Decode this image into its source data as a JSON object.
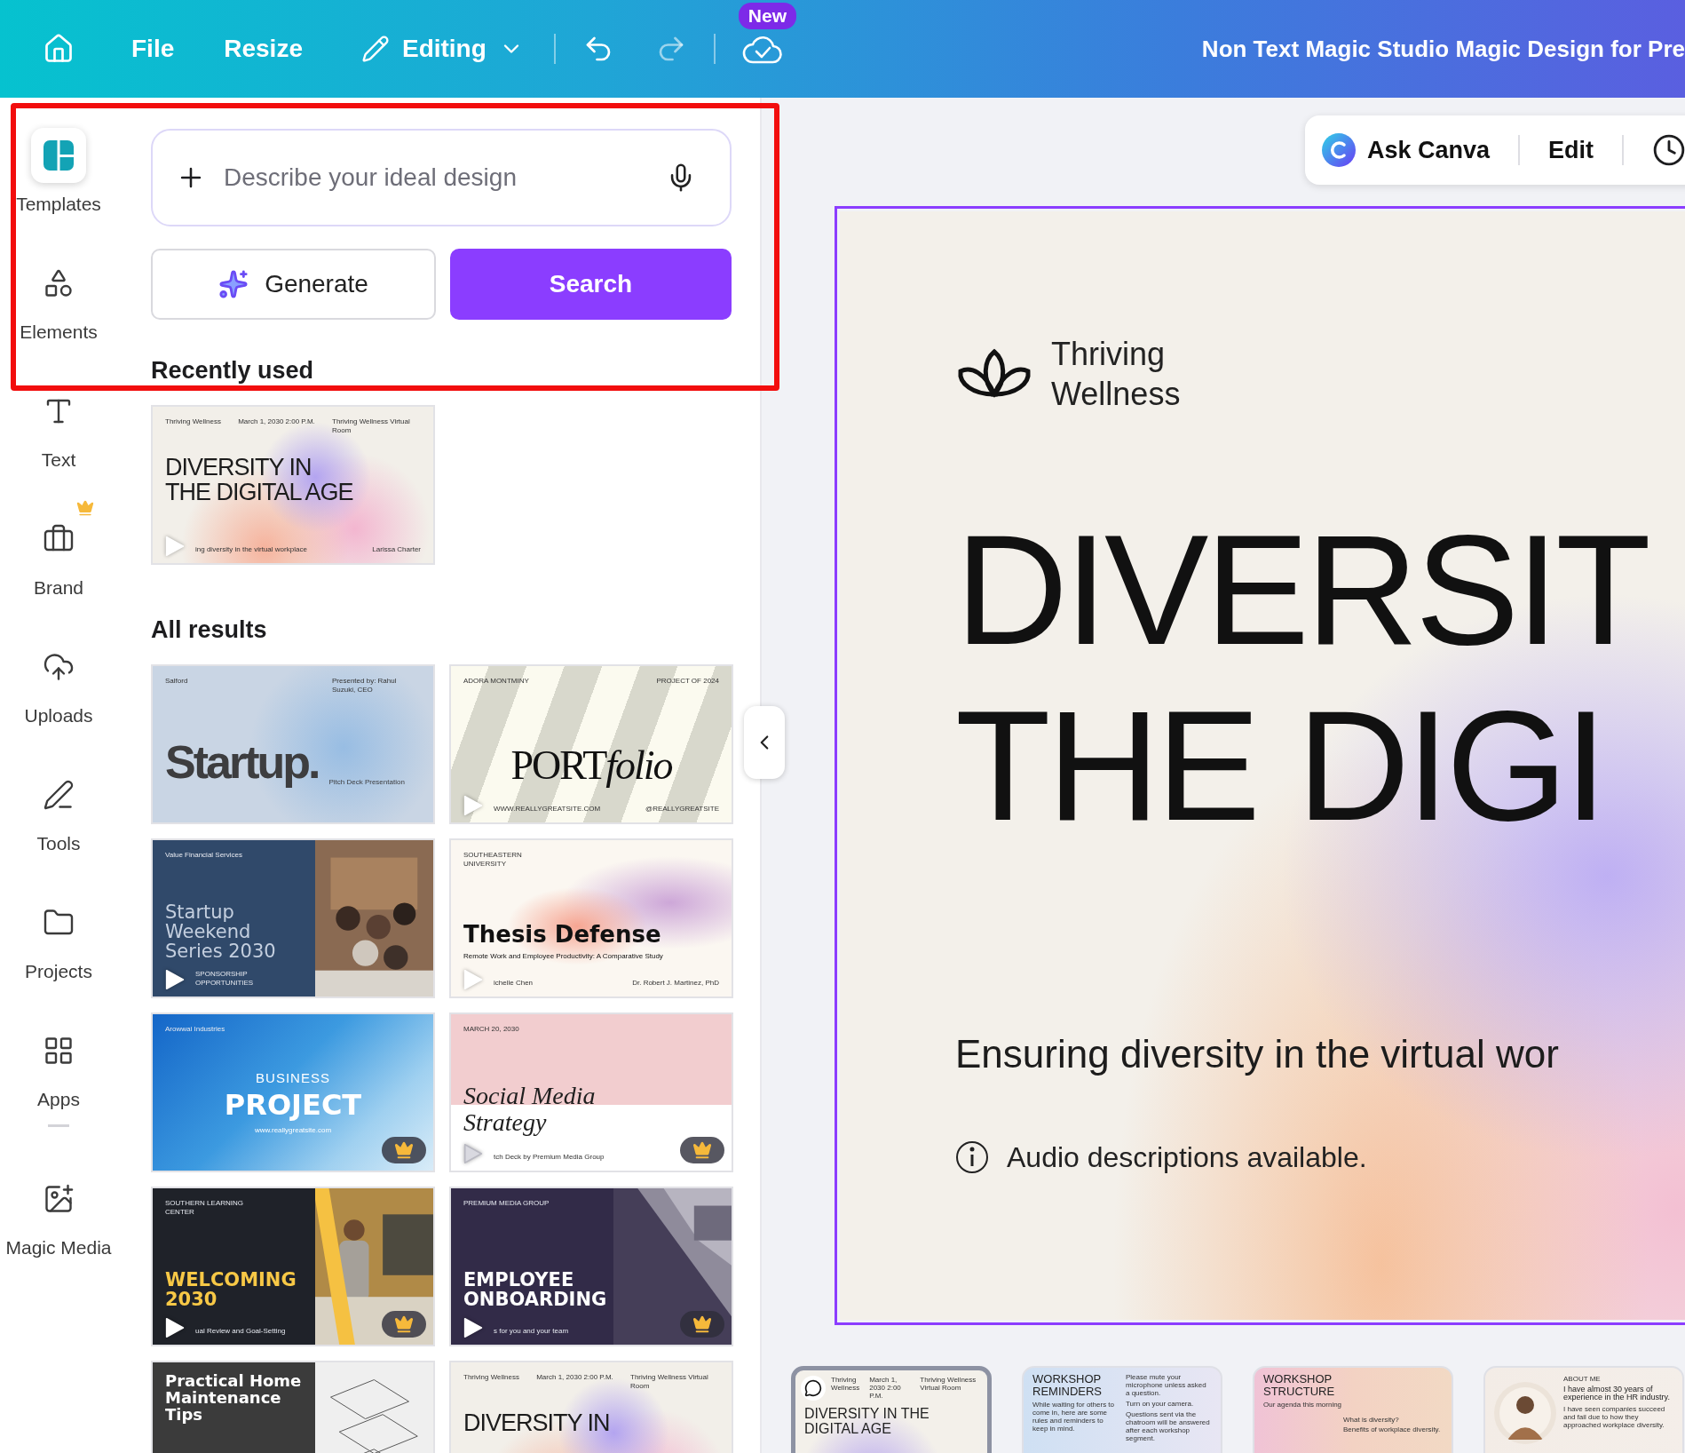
{
  "topbar": {
    "menu": [
      {
        "label": "File"
      },
      {
        "label": "Resize"
      }
    ],
    "mode": "Editing",
    "new_badge": "New",
    "title": "Non Text Magic Studio Magic Design for Pre"
  },
  "rail": [
    {
      "kind": "templates",
      "label": "Templates",
      "selected": true,
      "premium": false
    },
    {
      "kind": "elements",
      "label": "Elements",
      "selected": false,
      "premium": false
    },
    {
      "kind": "text",
      "label": "Text",
      "selected": false,
      "premium": false
    },
    {
      "kind": "brand",
      "label": "Brand",
      "selected": false,
      "premium": true
    },
    {
      "kind": "uploads",
      "label": "Uploads",
      "selected": false,
      "premium": false
    },
    {
      "kind": "tools",
      "label": "Tools",
      "selected": false,
      "premium": false
    },
    {
      "kind": "projects",
      "label": "Projects",
      "selected": false,
      "premium": false
    },
    {
      "kind": "apps",
      "label": "Apps",
      "selected": false,
      "premium": false
    },
    {
      "kind": "divider"
    },
    {
      "kind": "magic",
      "label": "Magic Media",
      "selected": false,
      "premium": false
    }
  ],
  "panel": {
    "search": {
      "placeholder": "Describe your ideal design"
    },
    "generate": "Generate",
    "search_button": "Search",
    "recent_heading": "Recently used",
    "recent": [
      {
        "kind": "diversity",
        "header": [
          "Thriving Wellness",
          "March 1, 2030 2:00 P.M.",
          "Thriving Wellness Virtual Room"
        ],
        "title": "DIVERSITY IN THE DIGITAL AGE",
        "footer": [
          "ing diversity in the virtual workplace",
          "Larissa Charter"
        ],
        "play": true,
        "premium": false
      }
    ],
    "results_heading": "All results",
    "results": [
      {
        "kind": "startup",
        "header": [
          "Salford",
          "Presented by: Rahul Suzuki, CEO"
        ],
        "title": "Startup.",
        "subtitle": "Pitch Deck Presentation",
        "play": false,
        "premium": false
      },
      {
        "kind": "portfolio",
        "header": [
          "ADORA MONTMINY",
          "PROJECT OF 2024"
        ],
        "title_parts": [
          {
            "text": "PORT",
            "italic": false
          },
          {
            "text": "folio",
            "italic": true
          }
        ],
        "footer": [
          "WWW.REALLYGREATSITE.COM",
          "@REALLYGREATSITE"
        ],
        "play": true,
        "premium": false
      },
      {
        "kind": "weekend",
        "header": [
          "Value Financial Services"
        ],
        "title": "Startup Weekend Series 2030",
        "footer": [
          "SPONSORSHIP OPPORTUNITIES"
        ],
        "play": true,
        "premium": false
      },
      {
        "kind": "thesis",
        "header": [
          "SOUTHEASTERN UNIVERSITY"
        ],
        "title": "Thesis Defense",
        "subtitle": "Remote Work and Employee Productivity: A Comparative Study",
        "footer": [
          "ichelle Chen",
          "Dr. Robert J. Martinez, PhD"
        ],
        "play": true,
        "premium": false
      },
      {
        "kind": "business",
        "header": [
          "Arowwai Industries"
        ],
        "kicker": "BUSINESS",
        "title": "PROJECT",
        "subtitle": "www.reallygreatsite.com",
        "play": false,
        "premium": true
      },
      {
        "kind": "social",
        "header": [
          "MARCH 20, 2030"
        ],
        "title": "Social Media Strategy",
        "footer": [
          "tch Deck by Premium Media Group"
        ],
        "play": true,
        "premium": true
      },
      {
        "kind": "welcoming",
        "header": [
          "SOUTHERN LEARNING CENTER"
        ],
        "title": "WELCOMING 2030",
        "footer": [
          "ual Review and Goal-Setting"
        ],
        "play": true,
        "premium": true
      },
      {
        "kind": "onboarding",
        "header": [
          "PREMIUM MEDIA GROUP"
        ],
        "title": "EMPLOYEE ONBOARDING",
        "footer": [
          "s for you and your team"
        ],
        "play": true,
        "premium": true
      },
      {
        "kind": "home",
        "title": "Practical Home Maintenance Tips",
        "play": false,
        "premium": false
      },
      {
        "kind": "diversity",
        "header": [
          "Thriving Wellness",
          "March 1, 2030 2:00 P.M.",
          "Thriving Wellness Virtual Room"
        ],
        "title": "DIVERSITY IN",
        "play": false,
        "premium": false
      }
    ]
  },
  "canvas": {
    "assistant": "Ask Canva",
    "edit": "Edit",
    "slide": {
      "brand": "Thriving Wellness",
      "headline": [
        "DIVERSIT",
        "THE DIGI"
      ],
      "tagline": "Ensuring diversity in the virtual wor",
      "note": "Audio descriptions available."
    },
    "pages": [
      {
        "kind": "diversity",
        "selected": true,
        "header": [
          "Thriving Wellness",
          "March 1, 2030 2:00 P.M.",
          "Thriving Wellness Virtual Room"
        ],
        "title": "DIVERSITY IN THE DIGITAL AGE"
      },
      {
        "kind": "reminders",
        "selected": false,
        "title": "WORKSHOP REMINDERS",
        "body": "While waiting for others to come in, here are some rules and reminders to keep in mind.",
        "list": [
          "Please mute your microphone unless asked a question.",
          "Turn on your camera.",
          "Questions sent via the chatroom will be answered after each workshop segment."
        ]
      },
      {
        "kind": "structure",
        "selected": false,
        "title": "WORKSHOP STRUCTURE",
        "body": "Our agenda this morning",
        "list": [
          "What is diversity?",
          "Benefits of workplace diversity."
        ]
      },
      {
        "kind": "about",
        "selected": false,
        "eyebrow": "ABOUT ME",
        "title": "I have almost 30 years of experience in the HR industry.",
        "body": "I have seen companies succeed and fail due to how they approached workplace diversity."
      }
    ]
  }
}
